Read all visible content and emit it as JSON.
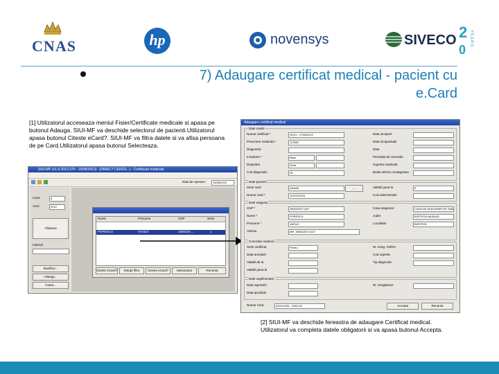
{
  "logos": {
    "cnas": "CNAS",
    "hp": "hp",
    "novensys": "novensys",
    "siveco": "SIVECO",
    "siveco_years": "YEARS"
  },
  "slide": {
    "title_line1": "7) Adaugare certificat medical - pacient cu",
    "title_line2": "e.Card",
    "note1": "[1] Utilizatorul acceseaza meniul Fisier/Certificate medicale si apasa pe butonul Adauga. SIUI-MF va deschide selectorul de pacienti.Utilizatorul apasa butonul Citeste eCard?. SIUI-MF va filtra datele si va afisa persoana de pe Card.Utilizatorul apasa butonul Selecteaza.",
    "note2": "[2] SIUI-MF va deschide fereastra de adaugare Certificat medical. Utilizatorul va completa datele obligatorii si va apasa butonul Accepta."
  },
  "left_window": {
    "title": "SIUI-MF (v1.5.2012.270 - 15/08/2013) - [DIRECT CERCE...] - Certificate medicale",
    "menu": [
      "Fisier",
      "Rapoarte",
      "Utilitare",
      "Configurari",
      "Ferestre",
      "Ajutor"
    ],
    "date_label": "Data de operare:",
    "date_value": "15/08/2013",
    "side_labels": [
      "Luna:",
      "Anul:"
    ],
    "luna_value": "8",
    "anul_value": "2012",
    "side_buttons": [
      "Afiseaza",
      "Modifica...",
      "Adauga...",
      "Cauta..."
    ],
    "filter_label": "Interval",
    "grid_headers": [
      "Nume",
      "Prenume",
      "CNP",
      "Serie"
    ],
    "grid_row": [
      "POPESCU",
      "VASILE",
      "1800220.....",
      "1"
    ],
    "dialog_buttons": [
      "Citeste eCard?",
      "Sterge filtru",
      "Citeste eCard?",
      "Selecteaza",
      "Renunta"
    ]
  },
  "right_window": {
    "title": "Adaugare certificat medical",
    "section_date": "Date medic",
    "fields_left": [
      {
        "label": "Numar certificat *",
        "value": "10/13 - 17/08/2013"
      },
      {
        "label": "Prescriere medicala *",
        "value": "123352"
      },
      {
        "label": "Diagnostic",
        "value": ""
      },
      {
        "label": "Incadrare *",
        "value": "Base"
      },
      {
        "label": "Depistare",
        "value": "Seria"
      },
      {
        "label": "Cod diagnostic",
        "value": "30"
      }
    ],
    "fields_right": [
      {
        "label": "Data inceperii",
        "value": ""
      },
      {
        "label": "Data incapacitatii",
        "value": ""
      },
      {
        "label": "Data",
        "value": ""
      },
      {
        "label": "Perioada de concediu",
        "value": ""
      },
      {
        "label": "Urgenta medicala",
        "value": ""
      },
      {
        "label": "Boala infecto-contagioasa",
        "value": ""
      }
    ],
    "section_pacient": "Date pacient",
    "pacient_left": [
      {
        "label": "Serie card",
        "value": "AAAAA"
      },
      {
        "label": "Numar card *",
        "value": "1222222224"
      }
    ],
    "pacient_right": [
      {
        "label": "Valabil pana la",
        "value": "5"
      },
      {
        "label": "Cod indemnizatie",
        "value": ""
      }
    ],
    "section_asigurat": "Date asigurat",
    "asigurat_left": [
      {
        "label": "CNP *",
        "value": "2800220171157"
      },
      {
        "label": "Nume *",
        "value": "POPESCU"
      },
      {
        "label": "Prenume *",
        "value": "VASILE"
      },
      {
        "label": "Adresa",
        "value": "MR. 2800220171157"
      }
    ],
    "asigurat_right": [
      {
        "label": "Casa asigurare",
        "value": "CASA DE ASIGURARI DE SANATATE BIS"
      },
      {
        "label": "Judet",
        "value": "BISTRITA-NASAUD"
      },
      {
        "label": "Localitate",
        "value": "BISTRITA"
      }
    ],
    "section_concediu": "Concediu medical",
    "concediu_left": [
      {
        "label": "Serie certificat",
        "value": "Pentru"
      },
      {
        "label": "Data acordarii",
        "value": ""
      },
      {
        "label": "Valabil de la",
        "value": ""
      },
      {
        "label": "Valabil pana la",
        "value": ""
      }
    ],
    "concediu_right": [
      {
        "label": "Nr. inreg. FZ/DO",
        "value": ""
      },
      {
        "label": "Cod urgenta",
        "value": ""
      },
      {
        "label": "Tip diagnostic",
        "value": ""
      }
    ],
    "section_extra": "Date suplimentare",
    "extra_fields": [
      "Data raportarii",
      "Data aprobarii",
      "Nr. inregistrare"
    ],
    "footer_label": "Numar Card",
    "footer_value": "AH101345 - 1000142",
    "buttons": [
      "Accepta",
      "Renunta"
    ]
  },
  "colors": {
    "title_blue": "#1a7fb4",
    "footer_band": "#1b8db5",
    "selected_row": "#243f96"
  }
}
